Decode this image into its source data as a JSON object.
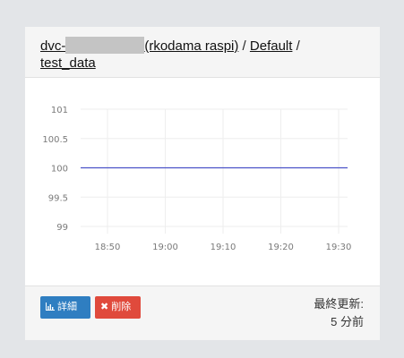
{
  "header": {
    "device_prefix": "dvc-",
    "device_suffix": "(rkodama raspi)",
    "sep1": " / ",
    "group_link": "Default",
    "sep2": " /",
    "data_link": "test_data"
  },
  "chart_data": {
    "type": "line",
    "x": [
      "18:50",
      "19:00",
      "19:10",
      "19:20",
      "19:30"
    ],
    "series": [
      {
        "values": [
          100,
          100,
          100,
          100,
          100
        ],
        "color": "#4b52c8"
      }
    ],
    "y_ticks": [
      "101",
      "100.5",
      "100",
      "99.5",
      "99"
    ],
    "x_ticks": [
      "18:50",
      "19:00",
      "19:10",
      "19:20",
      "19:30"
    ],
    "ylim": [
      99,
      101
    ],
    "grid": true,
    "xlabel": "",
    "ylabel": "",
    "title": ""
  },
  "footer": {
    "detail_icon": "chart-icon",
    "detail_label": "詳細",
    "delete_icon": "close-icon",
    "delete_label": "削除",
    "updated_label": "最終更新:",
    "updated_value": "5 分前"
  },
  "colors": {
    "detail": "#2f7ec1",
    "delete": "#e04a3c",
    "line": "#4b52c8"
  }
}
